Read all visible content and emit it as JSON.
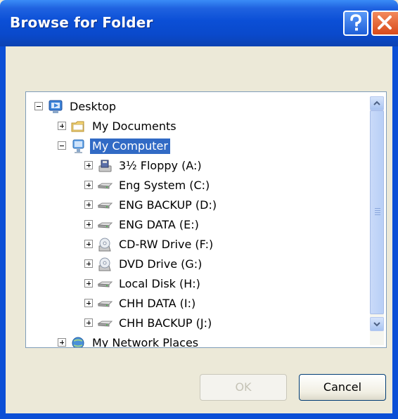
{
  "window": {
    "title": "Browse for Folder",
    "description": ""
  },
  "tree": {
    "items": [
      {
        "label": "Desktop",
        "icon": "desktop-icon",
        "expander": "minus",
        "level": 0
      },
      {
        "label": "My Documents",
        "icon": "folder-icon",
        "expander": "plus",
        "level": 1
      },
      {
        "label": "My Computer",
        "icon": "computer-icon",
        "expander": "minus",
        "level": 1,
        "selected": true
      },
      {
        "label": "3½ Floppy (A:)",
        "icon": "floppy-drive-icon",
        "expander": "plus",
        "level": 2
      },
      {
        "label": "Eng System (C:)",
        "icon": "hard-drive-icon",
        "expander": "plus",
        "level": 2
      },
      {
        "label": "ENG BACKUP (D:)",
        "icon": "hard-drive-icon",
        "expander": "plus",
        "level": 2
      },
      {
        "label": "ENG DATA (E:)",
        "icon": "hard-drive-icon",
        "expander": "plus",
        "level": 2
      },
      {
        "label": "CD-RW Drive (F:)",
        "icon": "cd-drive-icon",
        "expander": "plus",
        "level": 2
      },
      {
        "label": "DVD Drive (G:)",
        "icon": "cd-drive-icon",
        "expander": "plus",
        "level": 2
      },
      {
        "label": "Local Disk (H:)",
        "icon": "hard-drive-icon",
        "expander": "plus",
        "level": 2
      },
      {
        "label": "CHH DATA (I:)",
        "icon": "hard-drive-icon",
        "expander": "plus",
        "level": 2
      },
      {
        "label": "CHH BACKUP (J:)",
        "icon": "hard-drive-icon",
        "expander": "plus",
        "level": 2
      },
      {
        "label": "My Network Places",
        "icon": "network-icon",
        "expander": "plus",
        "level": 1
      }
    ]
  },
  "buttons": {
    "ok": "OK",
    "cancel": "Cancel"
  },
  "colors": {
    "titlebar": "#0b4fd6",
    "selection": "#316ac5",
    "dialog_bg": "#ece9d8"
  }
}
